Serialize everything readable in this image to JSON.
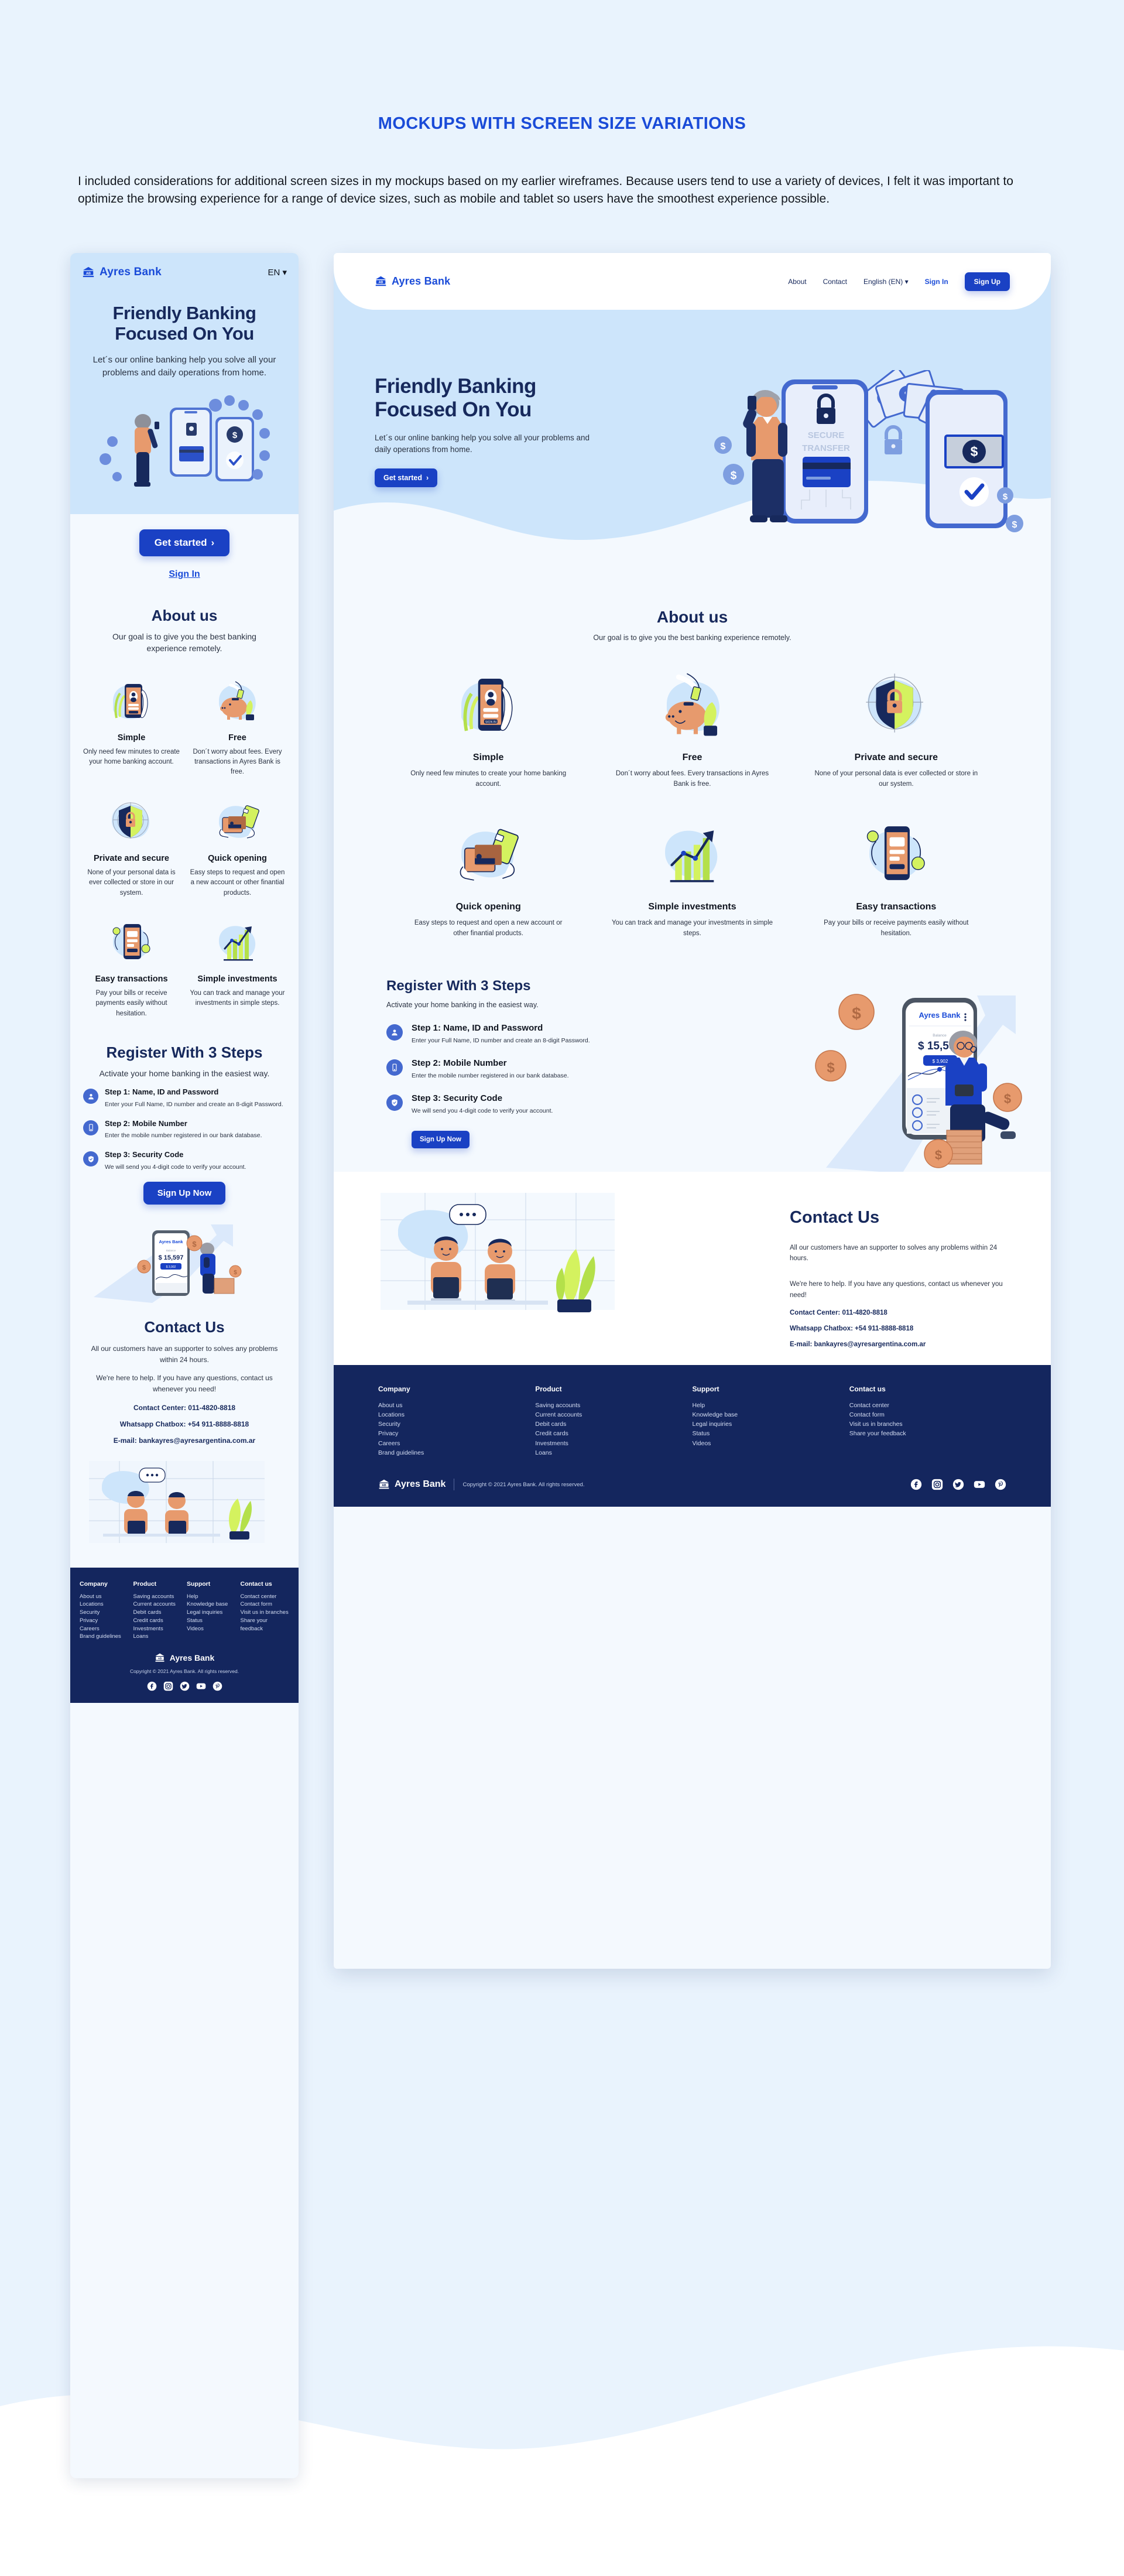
{
  "intro": {
    "title": "MOCKUPS WITH SCREEN SIZE VARIATIONS",
    "paragraph": "I included considerations for additional screen sizes in my mockups based on my earlier wireframes. Because users tend to use a variety of devices, I felt it was important to optimize the browsing experience for a range of device sizes, such as mobile and tablet so users have the smoothest experience possible."
  },
  "colors": {
    "brand_blue": "#1a4bd8",
    "button_blue": "#1a41c4",
    "navy": "#17295c",
    "footer_navy": "#14265e",
    "hero_blue": "#cde5fb",
    "page_bg": "#e9f3fd",
    "section_bg": "#f4f9fe"
  },
  "brand": {
    "name": "Ayres Bank",
    "mark": "AB"
  },
  "mobile": {
    "lang": "EN",
    "hero": {
      "h1_line1": "Friendly Banking",
      "h1_line2": "Focused On You",
      "sub": "Let´s our online banking help you solve all your problems and daily operations from home.",
      "cta": "Get started",
      "signin": "Sign In"
    },
    "about": {
      "title": "About us",
      "sub": "Our goal is to give you the best banking experience remotely.",
      "cards": [
        {
          "title": "Simple",
          "desc": "Only need few minutes to create your home banking account.",
          "icon": "phone-signin-icon"
        },
        {
          "title": "Free",
          "desc": "Don´t worry about fees. Every transactions in Ayres Bank is free.",
          "icon": "piggy-bank-icon"
        },
        {
          "title": "Private and secure",
          "desc": "None of your personal data is ever collected or store in our system.",
          "icon": "shield-lock-icon"
        },
        {
          "title": "Quick opening",
          "desc": "Easy steps to request and open a new account or other finantial products.",
          "icon": "wallet-card-icon"
        },
        {
          "title": "Easy transactions",
          "desc": "Pay your bills or receive payments easily without hesitation.",
          "icon": "phone-transfer-icon"
        },
        {
          "title": "Simple investments",
          "desc": "You can track and manage your investments in simple steps.",
          "icon": "growth-chart-icon"
        }
      ]
    },
    "register": {
      "title": "Register With 3 Steps",
      "sub": "Activate your home banking in the easiest way.",
      "steps": [
        {
          "title": "Step 1: Name, ID and Password",
          "desc": "Enter your Full Name, ID number and create an 8-digit Password.",
          "icon": "person-icon"
        },
        {
          "title": "Step 2: Mobile Number",
          "desc": "Enter the mobile number registered in our bank database.",
          "icon": "mobile-icon"
        },
        {
          "title": "Step 3: Security Code",
          "desc": "We will send you 4-digit code to verify your account.",
          "icon": "shield-check-icon"
        }
      ],
      "cta": "Sign Up Now"
    },
    "contact": {
      "title": "Contact Us",
      "p1": "All our customers have an supporter to solves any problems within 24 hours.",
      "p2": "We're here to help. If you have any questions, contact us whenever you need!",
      "line1": "Contact Center: 011-4820-8818",
      "line2": "Whatsapp Chatbox: +54 911-8888-8818",
      "line3": "E-mail: bankayres@ayresargentina.com.ar"
    }
  },
  "desktop": {
    "nav": {
      "items": [
        "About",
        "Contact"
      ],
      "language": "English (EN)",
      "signin": "Sign In",
      "signup": "Sign Up"
    },
    "hero": {
      "h1_line1": "Friendly Banking",
      "h1_line2": "Focused On You",
      "sub": "Let´s our online banking help you solve all your problems and daily operations from home.",
      "cta": "Get started"
    },
    "about": {
      "title": "About us",
      "sub": "Our goal is to give you the best banking experience remotely.",
      "cards": [
        {
          "title": "Simple",
          "desc": "Only need few minutes to create your home banking account.",
          "icon": "phone-signin-icon"
        },
        {
          "title": "Free",
          "desc": "Don´t worry about fees. Every transactions in Ayres Bank is free.",
          "icon": "piggy-bank-icon"
        },
        {
          "title": "Private and secure",
          "desc": "None of your personal data is ever collected or store in our system.",
          "icon": "shield-lock-icon"
        },
        {
          "title": "Quick opening",
          "desc": "Easy steps to request and open a new account or other finantial products.",
          "icon": "wallet-card-icon"
        },
        {
          "title": "Simple investments",
          "desc": "You can track and manage your investments in simple steps.",
          "icon": "growth-chart-icon"
        },
        {
          "title": "Easy transactions",
          "desc": "Pay your bills or receive payments easily without hesitation.",
          "icon": "phone-transfer-icon"
        }
      ]
    },
    "register": {
      "title": "Register With 3 Steps",
      "sub": "Activate your home banking in the easiest way.",
      "steps": [
        {
          "title": "Step 1: Name, ID and Password",
          "desc": "Enter your Full Name, ID number and create an 8-digit Password.",
          "icon": "person-icon"
        },
        {
          "title": "Step 2: Mobile Number",
          "desc": "Enter the mobile number registered in our bank database.",
          "icon": "mobile-icon"
        },
        {
          "title": "Step 3: Security Code",
          "desc": "We will send you 4-digit code to verify your account.",
          "icon": "shield-check-icon"
        }
      ],
      "cta": "Sign Up Now",
      "phone_mock": {
        "app": "Ayres Bank",
        "balance_label": "Balance",
        "balance": "$ 15,597",
        "tooltip": "$ 3,902"
      }
    },
    "contact": {
      "title": "Contact Us",
      "p1": "All our customers have an supporter to solves any problems within 24 hours.",
      "p2": "We're here to help. If you have any questions, contact us whenever you need!",
      "line1": "Contact Center: 011-4820-8818",
      "line2": "Whatsapp Chatbox: +54 911-8888-8818",
      "line3": "E-mail: bankayres@ayresargentina.com.ar"
    }
  },
  "footer": {
    "columns": [
      {
        "heading": "Company",
        "links": [
          "About us",
          "Locations",
          "Security",
          "Privacy",
          "Careers",
          "Brand guidelines"
        ]
      },
      {
        "heading": "Product",
        "links": [
          "Saving accounts",
          "Current accounts",
          "Debit cards",
          "Credit cards",
          "Investments",
          "Loans"
        ]
      },
      {
        "heading": "Support",
        "links": [
          "Help",
          "Knowledge base",
          "Legal inquiries",
          "Status",
          "Videos"
        ]
      },
      {
        "heading": "Contact us",
        "links": [
          "Contact center",
          "Contact form",
          "Visit us in branches",
          "Share your feedback"
        ]
      }
    ],
    "copyright": "Copyright © 2021 Ayres Bank. All rights reserved.",
    "socials": [
      "facebook-icon",
      "instagram-icon",
      "twitter-icon",
      "youtube-icon",
      "pinterest-icon"
    ]
  }
}
